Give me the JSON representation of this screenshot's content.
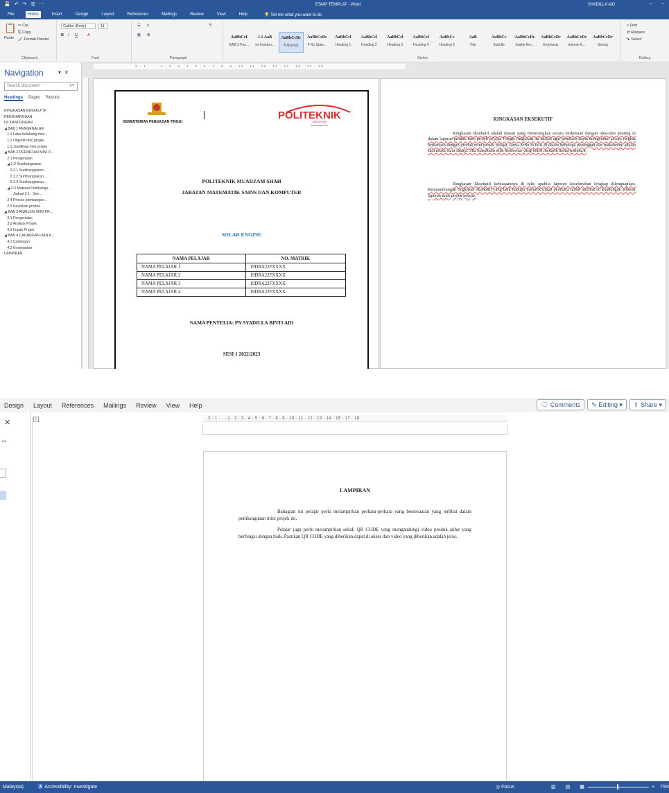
{
  "top": {
    "titlebar": {
      "doc_title": "ESMP TEMPLAT - Word",
      "user": "SYADILLA AID",
      "qat": [
        "💾",
        "↶",
        "↷",
        "🖫",
        "⋯"
      ]
    },
    "ribbon_tabs": [
      "File",
      "Home",
      "Insert",
      "Design",
      "Layout",
      "References",
      "Mailings",
      "Review",
      "View",
      "Help"
    ],
    "tell_me": "Tell me what you want to do",
    "clipboard": {
      "paste": "Paste",
      "cut": "Cut",
      "copy": "Copy",
      "painter": "Format Painter",
      "label": "Clipboard"
    },
    "font": {
      "name": "Calibri (Body)",
      "size": "11",
      "label": "Font"
    },
    "paragraph_label": "Paragraph",
    "styles": {
      "label": "Styles",
      "items": [
        {
          "preview": "AaBbCcI",
          "name": "BAB 2 Pas..."
        },
        {
          "preview": "1.1 AaB",
          "name": "isi Kandun..."
        },
        {
          "preview": "AaBbCcDc",
          "name": "¶ Normal"
        },
        {
          "preview": "AaBbCcDc",
          "name": "¶ No Spac..."
        },
        {
          "preview": "AaBbCcl",
          "name": "Heading 1"
        },
        {
          "preview": "AaBbCcl",
          "name": "Heading 2"
        },
        {
          "preview": "AaBbCcl",
          "name": "Heading 3"
        },
        {
          "preview": "AaBbCcl",
          "name": "Heading 4"
        },
        {
          "preview": "AaBbCc",
          "name": "Heading 5"
        },
        {
          "preview": "AaB",
          "name": "Title"
        },
        {
          "preview": "AaBbCc",
          "name": "Subtitle"
        },
        {
          "preview": "AaBbCcDc",
          "name": "Subtle Em..."
        },
        {
          "preview": "AaBbCcDc",
          "name": "Emphasis"
        },
        {
          "preview": "AaBbCcDc",
          "name": "Intense E..."
        },
        {
          "preview": "AaBbCcDc",
          "name": "Strong"
        }
      ]
    },
    "editing": {
      "find": "Find",
      "replace": "Replace",
      "select": "Select",
      "label": "Editing"
    },
    "nav": {
      "title": "Navigation",
      "search_placeholder": "Search document",
      "tabs": [
        "Headings",
        "Pages",
        "Results"
      ],
      "headings": [
        "RINGKASAN EKSEKUTIF",
        "PENGHARGAAN",
        "ISI KANDUNGAN",
        "◢ BAB 1 PENGENALAN",
        "   1.1 Latar belakang mini...",
        "   1.2 Objektif mini projek",
        "   1.3 Justifikasi mini projek",
        "◢ BAB 2 PERINCIAN MINI P...",
        "   2.1 Pengenalan",
        "   ◢ 2.2 Sumbangsaran",
        "      2.2.1 Sumbangsaran...",
        "      2.2.2 Sumbangsaran...",
        "      2.2.3 Sumbangsaran...",
        "   ◢ 2.3 Material Pembangu...",
        "         Jadual 2.1 : Sen...",
        "   2.4 Proses pembangun...",
        "   2.5 Keunikan produk",
        "◢ BAB 3 ANALISIS MINI PR...",
        "   3.1 Pengenalan",
        "   3.2 Analisis Projek",
        "   3.3 Impak Projek",
        "◢ BAB 4 CADANGAN DAN K...",
        "   4.1 Cadangan",
        "   4.2 Kesimpulan",
        "LAMPIRAN"
      ]
    },
    "ruler_text": "2 · 1 · · · 1 · 2 · 3 · 4 · 5 · 6 · 7 · 8 · 9 · 10 · 11 · 12 · 13 · 14 · 15 · 17 · 18",
    "cover": {
      "ministry": "KEMENTERIAN PENGAJIAN TINGGI",
      "logo_text": "POLITEKNIK",
      "logo_sub": "MALAYSIA",
      "logo_sub2": "MUADZAM SHAH",
      "institution": "POLITEKNIK MUADZAM SHAH",
      "department": "JABATAN MATEMATIK SAINS DAN KOMPUTER",
      "project": "SOLAR ENGINE",
      "table": {
        "headers": [
          "NAMA PELAJAR",
          "NO. MATRIK"
        ],
        "rows": [
          [
            "NAMA PELAJAR 1",
            "19DRA22FXXXX"
          ],
          [
            "NAMA PELAJAR 2",
            "19DRA22FXXXX"
          ],
          [
            "NAMA PELAJAR 3",
            "19DRA22FXXXX"
          ],
          [
            "NAMA PELAJAR 4",
            "19DRA22FXXXX"
          ]
        ]
      },
      "supervisor": "NAMA PENYELIA: PN SYADILLA BINTI AID",
      "session": "SESI 1 2022/2023"
    },
    "exec": {
      "title": "RINGKASAN EKSEKUTIF",
      "p1": "Ringkasan eksekutif adalah ulasan yang menerangkan secara berkenaan dengan idea-idea penting di dalam laporan produk mini projek pelajar. Fungsi ringkasan ini adalah agar pembaca dapat mengetahui secara ringkas berkenaan dengan produk mini projek pelajar. Ianya perlu di tulis di dalam beberapa perenggan dan maksimum adalah satu muka surat sahaja. Sila masukkan nilai komersial yang boleh menarik minat pembaca.",
      "p2": "Ringkasan Eksekutif kebiasaannya di tulis apabila laporan keseluruhan lengkap dilengkapkan. Kesinambungan ringkasan eksekutif yang baik mampu menarik minat pembaca untuk melihat isi kandungan sebenar laporan mini projek pelajar."
    }
  },
  "bottom": {
    "menu": [
      "Design",
      "Layout",
      "References",
      "Mailings",
      "Review",
      "View",
      "Help"
    ],
    "comments": "Comments",
    "editing": "Editing",
    "share": "Share",
    "ruler_text": "2 · 1 · · · 1 · 2 · 3 · 4 · 5 · 6 · 7 · 8 · 9 · 10 · 11 · 12 · 13 · 14 · 15 · 17 · 18",
    "lampiran": {
      "title": "LAMPIRAN",
      "p1": "Bahagian ini pelajar perlu melampirkan perkara-perkara yang bersesuaian yang terlibat dalam pembangunan mini projek ini.",
      "p2": "Pelajar juga perlu melampirkan sekali QR CODE yang mengandungi video produk akhir yang berfungsi dengan baik. Pastikan QR CODE yang diberikan dapat di akses dan video yang diberikan adalah jelas."
    },
    "status": {
      "language": "Malaysia)",
      "accessibility": "Accessibility: Investigate",
      "focus": "Focus",
      "zoom": "75%"
    }
  }
}
